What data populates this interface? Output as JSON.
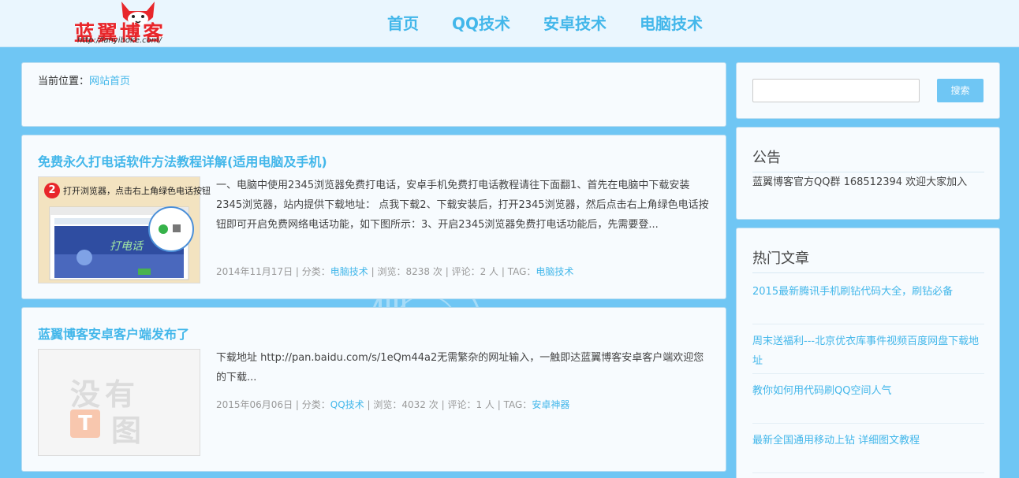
{
  "header": {
    "logo_text": "蓝翼博客",
    "logo_url": "http://lanyiboke.com/",
    "nav": [
      "首页",
      "QQ技术",
      "安卓技术",
      "电脑技术"
    ]
  },
  "breadcrumb": {
    "label": "当前位置：",
    "link": "网站首页"
  },
  "posts": [
    {
      "title": "免费永久打电话软件方法教程详解(适用电脑及手机)",
      "thumb_step": "2",
      "thumb_caption": "打开浏览器，点击右上角绿色电话按钮",
      "excerpt": "一、电脑中使用2345浏览器免费打电话，安卓手机免费打电话教程请往下面翻1、首先在电脑中下载安装2345浏览器，站内提供下载地址： 点我下载2、下载安装后，打开2345浏览器，然后点击右上角绿色电话按钮即可开启免费网络电话功能，如下图所示：3、开启2345浏览器免费打电话功能后，先需要登...",
      "date": "2014年11月17日",
      "category_label": "分类：",
      "category": "电脑技术",
      "views_label": "浏览：",
      "views": "8238 次",
      "comments_label": "评论：",
      "comments": "2 人",
      "tag_label": "TAG：",
      "tag": "电脑技术"
    },
    {
      "title": "蓝翼博客安卓客户端发布了",
      "thumb_line1": "没有",
      "thumb_line2": "图",
      "excerpt": "下载地址 http://pan.baidu.com/s/1eQm44a2无需繁杂的网址输入，一触即达蓝翼博客安卓客户端欢迎您的下载...",
      "date": "2015年06月06日",
      "category_label": "分类：",
      "category": "QQ技术",
      "views_label": "浏览：",
      "views": "4032 次",
      "comments_label": "评论：",
      "comments": "1 人",
      "tag_label": "TAG：",
      "tag": "安卓神器"
    }
  ],
  "sidebar": {
    "search_button": "搜索",
    "notice_title": "公告",
    "notice_text": "蓝翼博客官方QQ群 168512394 欢迎大家加入",
    "hot_title": "热门文章",
    "hot_items": [
      "2015最新腾讯手机刷钻代码大全，刷钻必备",
      "周末送福利---北京优衣库事件视频百度网盘下载地址",
      "教你如何用代码刷QQ空间人气",
      "最新全国通用移动上钻 详细图文教程"
    ]
  },
  "colors": {
    "page_bg": "#6fc6f4",
    "accent": "#43b7ea",
    "logo_red": "#e8262b"
  }
}
